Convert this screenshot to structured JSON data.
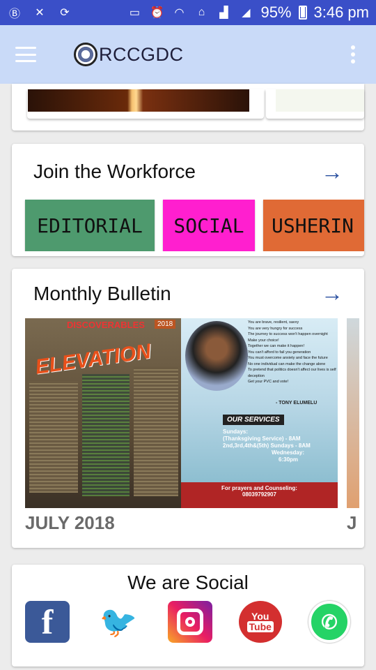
{
  "status": {
    "battery": "95%",
    "time": "3:46 pm"
  },
  "app": {
    "title": "RCCGDC"
  },
  "workforce": {
    "title": "Join the Workforce",
    "tiles": [
      {
        "label": "EDITORIAL",
        "color": "#4e9a6e"
      },
      {
        "label": "SOCIAL",
        "color": "#ff1fcf"
      },
      {
        "label": "USHERIN",
        "color": "#e06a35"
      }
    ]
  },
  "bulletin": {
    "title": "Monthly Bulletin",
    "items": [
      {
        "month": "JULY 2018"
      },
      {
        "month": "J"
      }
    ],
    "image": {
      "tag": "2018",
      "brand": "DISCOVERABLES",
      "headline": "ELEVATION",
      "quotes": [
        "You are brave, resilient, savvy",
        "You are very hungry for success",
        "The journey to success won't happen overnight",
        "Make your choice!",
        "Together we can make it happen!",
        "You can't afford to fail you generation",
        "You must overcome anxiety and face the future",
        "No one individual can make the change alone",
        "To pretend that politics doesn't affect our lives is self deception",
        "Get your PVC and vote!"
      ],
      "quote_author": "- TONY ELUMELU",
      "services_title": "OUR SERVICES",
      "services_lines": [
        "Sundays:",
        "(Thanksgiving Service) - 8AM",
        "2nd,3rd,4th&(5th) Sundays - 8AM",
        "Wednesday:",
        "6:30pm"
      ],
      "counsel_title": "For prayers and Counseling:",
      "counsel_phone": "08039792907"
    }
  },
  "social": {
    "title": "We are Social",
    "items": [
      {
        "name": "facebook",
        "color": "#3b5998"
      },
      {
        "name": "twitter",
        "color": "#1da1f2"
      },
      {
        "name": "instagram",
        "color": "#c13584"
      },
      {
        "name": "youtube",
        "color": "#d32f2f"
      },
      {
        "name": "whatsapp",
        "color": "#25d366"
      }
    ]
  }
}
